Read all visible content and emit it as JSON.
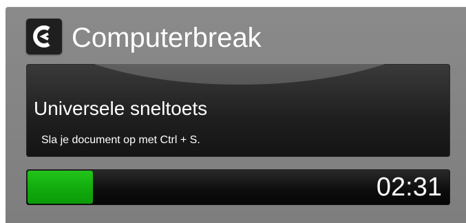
{
  "app": {
    "title": "Computerbreak",
    "logo_icon": "computerbreak-logo-icon"
  },
  "tip": {
    "title": "Universele sneltoets",
    "text": "Sla je document op met Ctrl + S."
  },
  "progress": {
    "fraction": 0.155,
    "time_remaining": "02:31",
    "fill_color": "#12b00f"
  }
}
